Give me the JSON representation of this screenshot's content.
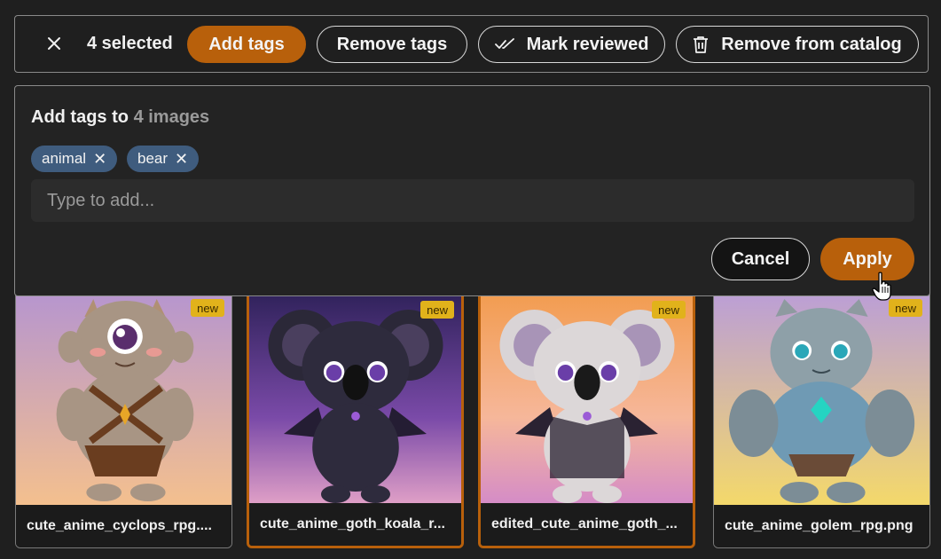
{
  "toolbar": {
    "selected_label": "4 selected",
    "add_tags": "Add tags",
    "remove_tags": "Remove tags",
    "mark_reviewed": "Mark reviewed",
    "remove_from_catalog": "Remove from catalog"
  },
  "panel": {
    "title_prefix": "Add tags to",
    "title_count": "4 images",
    "chips": [
      "animal",
      "bear"
    ],
    "input_placeholder": "Type to add...",
    "cancel": "Cancel",
    "apply": "Apply"
  },
  "cards": [
    {
      "filename": "cute_anime_cyclops_rpg....",
      "badge": "new",
      "selected": false
    },
    {
      "filename": "cute_anime_goth_koala_r...",
      "badge": "new",
      "selected": true
    },
    {
      "filename": "edited_cute_anime_goth_...",
      "badge": "new",
      "selected": true
    },
    {
      "filename": "cute_anime_golem_rpg.png",
      "badge": "new",
      "selected": false
    }
  ],
  "colors": {
    "accent": "#b8600b",
    "chip": "#3f5c7e",
    "badge": "#e1b21b",
    "background": "#1f1f1f"
  },
  "icons": [
    "close-icon",
    "double-check-icon",
    "trash-icon",
    "chip-remove-icon",
    "hand-cursor-icon"
  ]
}
